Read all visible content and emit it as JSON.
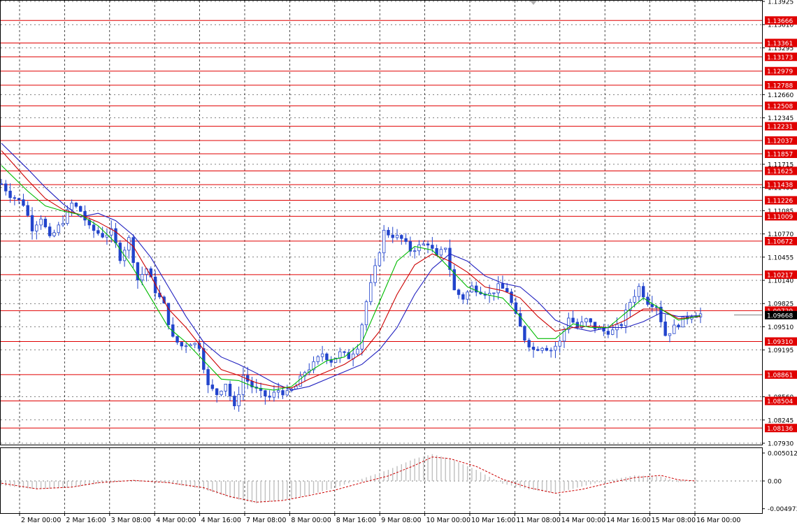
{
  "chart_data": [
    {
      "type": "line",
      "title": "",
      "description_series": "candlestick price with three moving averages",
      "y_price_labels": [
        "1.13925",
        "1.13610",
        "1.13295",
        "1.12660",
        "1.12345",
        "1.11715",
        "1.11400",
        "1.11085",
        "1.10770",
        "1.10455",
        "1.10140",
        "1.09825",
        "1.09510",
        "1.09195",
        "1.08560",
        "1.08245",
        "1.07930"
      ],
      "levels": [
        "1.13666",
        "1.13361",
        "1.13173",
        "1.12979",
        "1.12788",
        "1.12508",
        "1.12231",
        "1.12037",
        "1.11857",
        "1.11625",
        "1.11438",
        "1.11226",
        "1.11009",
        "1.10672",
        "1.10217",
        "1.09729",
        "1.09310",
        "1.08861",
        "1.08504",
        "1.08136"
      ],
      "current_price": "1.09668",
      "ylim": [
        1.0793,
        1.13925
      ],
      "x_labels": [
        "2 Mar 00:00",
        "2 Mar 16:00",
        "3 Mar 08:00",
        "4 Mar 00:00",
        "4 Mar 16:00",
        "7 Mar 08:00",
        "8 Mar 00:00",
        "8 Mar 16:00",
        "9 Mar 08:00",
        "10 Mar 00:00",
        "10 Mar 16:00",
        "11 Mar 08:00",
        "14 Mar 00:00",
        "14 Mar 16:00",
        "15 Mar 08:00",
        "16 Mar 00:00"
      ],
      "price_path": [
        [
          0,
          1.1145
        ],
        [
          2,
          1.113
        ],
        [
          5,
          1.1118
        ],
        [
          7,
          1.1085
        ],
        [
          9,
          1.11
        ],
        [
          11,
          1.107
        ],
        [
          14,
          1.1095
        ],
        [
          16,
          1.1118
        ],
        [
          18,
          1.1108
        ],
        [
          20,
          1.1085
        ],
        [
          23,
          1.1075
        ],
        [
          25,
          1.108
        ],
        [
          27,
          1.1045
        ],
        [
          29,
          1.107
        ],
        [
          31,
          1.1015
        ],
        [
          33,
          1.103
        ],
        [
          35,
          1.1
        ],
        [
          37,
          1.098
        ],
        [
          39,
          1.0935
        ],
        [
          41,
          1.0925
        ],
        [
          43,
          1.093
        ],
        [
          45,
          1.0925
        ],
        [
          47,
          1.087
        ],
        [
          49,
          1.086
        ],
        [
          51,
          1.0875
        ],
        [
          53,
          1.084
        ],
        [
          55,
          1.0885
        ],
        [
          57,
          1.087
        ],
        [
          59,
          1.086
        ],
        [
          61,
          1.0855
        ],
        [
          63,
          1.0865
        ],
        [
          65,
          1.086
        ],
        [
          67,
          1.087
        ],
        [
          69,
          1.089
        ],
        [
          71,
          1.09
        ],
        [
          73,
          1.0915
        ],
        [
          75,
          1.0905
        ],
        [
          77,
          1.0915
        ],
        [
          79,
          1.091
        ],
        [
          81,
          1.0925
        ],
        [
          83,
          1.0985
        ],
        [
          85,
          1.103
        ],
        [
          87,
          1.108
        ],
        [
          89,
          1.1075
        ],
        [
          91,
          1.107
        ],
        [
          93,
          1.1055
        ],
        [
          95,
          1.106
        ],
        [
          97,
          1.1065
        ],
        [
          99,
          1.1045
        ],
        [
          101,
          1.106
        ],
        [
          103,
          1.1
        ],
        [
          105,
          1.099
        ],
        [
          107,
          1.1005
        ],
        [
          109,
          1.1
        ],
        [
          111,
          1.0995
        ],
        [
          113,
          1.1005
        ],
        [
          115,
          1.1
        ],
        [
          117,
          1.0965
        ],
        [
          119,
          1.0935
        ],
        [
          121,
          1.092
        ],
        [
          123,
          1.0925
        ],
        [
          125,
          1.092
        ],
        [
          127,
          1.093
        ],
        [
          129,
          1.0965
        ],
        [
          131,
          1.095
        ],
        [
          133,
          1.096
        ],
        [
          135,
          1.095
        ],
        [
          137,
          1.0945
        ],
        [
          139,
          1.0945
        ],
        [
          141,
          1.0955
        ],
        [
          143,
          1.0985
        ],
        [
          145,
          1.1005
        ],
        [
          147,
          1.0985
        ],
        [
          149,
          1.098
        ],
        [
          151,
          1.094
        ],
        [
          153,
          1.095
        ],
        [
          155,
          1.096
        ],
        [
          157,
          1.0968
        ],
        [
          159,
          1.0968
        ]
      ],
      "series": [
        {
          "name": "",
          "color": "#1f1fbf",
          "values": [
            [
              0,
              1.12
            ],
            [
              6,
              1.1165
            ],
            [
              10,
              1.114
            ],
            [
              14,
              1.1118
            ],
            [
              18,
              1.11
            ],
            [
              22,
              1.1105
            ],
            [
              26,
              1.1095
            ],
            [
              30,
              1.1075
            ],
            [
              34,
              1.1045
            ],
            [
              38,
              1.1005
            ],
            [
              42,
              1.0965
            ],
            [
              46,
              1.093
            ],
            [
              50,
              1.091
            ],
            [
              54,
              1.09
            ],
            [
              58,
              1.0888
            ],
            [
              62,
              1.0875
            ],
            [
              66,
              1.0865
            ],
            [
              70,
              1.087
            ],
            [
              74,
              1.088
            ],
            [
              78,
              1.089
            ],
            [
              82,
              1.09
            ],
            [
              86,
              1.092
            ],
            [
              90,
              1.095
            ],
            [
              94,
              1.0995
            ],
            [
              98,
              1.103
            ],
            [
              102,
              1.105
            ],
            [
              106,
              1.104
            ],
            [
              110,
              1.102
            ],
            [
              114,
              1.101
            ],
            [
              118,
              1.1005
            ],
            [
              122,
              1.0985
            ],
            [
              126,
              1.096
            ],
            [
              130,
              1.095
            ],
            [
              134,
              1.0945
            ],
            [
              138,
              1.095
            ],
            [
              142,
              1.095
            ],
            [
              146,
              1.0958
            ],
            [
              150,
              1.097
            ],
            [
              154,
              1.0965
            ],
            [
              159,
              1.0966
            ]
          ]
        },
        {
          "name": "",
          "color": "#cc0000",
          "values": [
            [
              0,
              1.119
            ],
            [
              6,
              1.115
            ],
            [
              10,
              1.1125
            ],
            [
              14,
              1.111
            ],
            [
              18,
              1.1103
            ],
            [
              22,
              1.1093
            ],
            [
              26,
              1.108
            ],
            [
              30,
              1.106
            ],
            [
              34,
              1.102
            ],
            [
              38,
              1.0975
            ],
            [
              42,
              1.095
            ],
            [
              46,
              1.092
            ],
            [
              50,
              1.0893
            ],
            [
              54,
              1.0885
            ],
            [
              58,
              1.0875
            ],
            [
              62,
              1.087
            ],
            [
              66,
              1.0868
            ],
            [
              70,
              1.088
            ],
            [
              74,
              1.089
            ],
            [
              78,
              1.09
            ],
            [
              82,
              1.0915
            ],
            [
              86,
              1.0945
            ],
            [
              90,
              1.0995
            ],
            [
              94,
              1.1035
            ],
            [
              98,
              1.105
            ],
            [
              102,
              1.104
            ],
            [
              106,
              1.1025
            ],
            [
              110,
              1.1005
            ],
            [
              114,
              1.1
            ],
            [
              118,
              1.099
            ],
            [
              122,
              1.0965
            ],
            [
              126,
              1.0945
            ],
            [
              130,
              1.095
            ],
            [
              134,
              1.0952
            ],
            [
              138,
              1.095
            ],
            [
              142,
              1.096
            ],
            [
              146,
              1.0975
            ],
            [
              150,
              1.0975
            ],
            [
              154,
              1.0962
            ],
            [
              159,
              1.0965
            ]
          ]
        },
        {
          "name": "",
          "color": "#00bb00",
          "values": [
            [
              0,
              1.117
            ],
            [
              6,
              1.1135
            ],
            [
              10,
              1.1115
            ],
            [
              14,
              1.1108
            ],
            [
              18,
              1.1103
            ],
            [
              22,
              1.1088
            ],
            [
              26,
              1.1065
            ],
            [
              30,
              1.103
            ],
            [
              34,
              1.099
            ],
            [
              38,
              1.095
            ],
            [
              42,
              1.093
            ],
            [
              46,
              1.0905
            ],
            [
              50,
              1.088
            ],
            [
              54,
              1.0878
            ],
            [
              58,
              1.0868
            ],
            [
              62,
              1.0865
            ],
            [
              66,
              1.087
            ],
            [
              70,
              1.089
            ],
            [
              74,
              1.0905
            ],
            [
              78,
              1.091
            ],
            [
              82,
              1.093
            ],
            [
              86,
              1.0985
            ],
            [
              90,
              1.104
            ],
            [
              94,
              1.106
            ],
            [
              98,
              1.1055
            ],
            [
              102,
              1.103
            ],
            [
              106,
              1.1005
            ],
            [
              110,
              1.0995
            ],
            [
              114,
              1.099
            ],
            [
              118,
              1.0965
            ],
            [
              122,
              1.0935
            ],
            [
              126,
              1.0935
            ],
            [
              130,
              1.0955
            ],
            [
              134,
              1.095
            ],
            [
              138,
              1.095
            ],
            [
              142,
              1.097
            ],
            [
              146,
              1.099
            ],
            [
              150,
              1.0975
            ],
            [
              154,
              1.096
            ],
            [
              159,
              1.0966
            ]
          ]
        }
      ]
    },
    {
      "type": "bar",
      "title": "",
      "y_labels": [
        "0.005012",
        "0.00",
        "-0.004973"
      ],
      "ylim": [
        -0.004973,
        0.005012
      ],
      "histogram": [
        [
          0,
          -0.0008
        ],
        [
          8,
          -0.0015
        ],
        [
          16,
          -0.0012
        ],
        [
          22,
          -0.0005
        ],
        [
          30,
          0.0002
        ],
        [
          38,
          -0.0004
        ],
        [
          46,
          -0.0015
        ],
        [
          52,
          -0.003
        ],
        [
          58,
          -0.004
        ],
        [
          64,
          -0.0035
        ],
        [
          70,
          -0.0025
        ],
        [
          76,
          -0.0012
        ],
        [
          82,
          0.0004
        ],
        [
          88,
          0.002
        ],
        [
          94,
          0.004
        ],
        [
          98,
          0.0048
        ],
        [
          102,
          0.004
        ],
        [
          108,
          0.002
        ],
        [
          114,
          -0.0005
        ],
        [
          120,
          -0.0015
        ],
        [
          126,
          -0.0022
        ],
        [
          132,
          -0.001
        ],
        [
          138,
          0.0001
        ],
        [
          144,
          0.001
        ],
        [
          150,
          0.0008
        ],
        [
          154,
          -0.0002
        ],
        [
          158,
          0.0002
        ]
      ],
      "signal": [
        [
          0,
          -0.0004
        ],
        [
          8,
          -0.0014
        ],
        [
          16,
          -0.0011
        ],
        [
          22,
          -0.0003
        ],
        [
          30,
          0.0001
        ],
        [
          38,
          -0.0003
        ],
        [
          46,
          -0.0012
        ],
        [
          52,
          -0.0028
        ],
        [
          58,
          -0.0038
        ],
        [
          64,
          -0.0035
        ],
        [
          70,
          -0.0026
        ],
        [
          76,
          -0.0016
        ],
        [
          82,
          -0.0003
        ],
        [
          88,
          0.0009
        ],
        [
          94,
          0.0028
        ],
        [
          98,
          0.0043
        ],
        [
          102,
          0.004
        ],
        [
          108,
          0.0026
        ],
        [
          114,
          0.0003
        ],
        [
          120,
          -0.0012
        ],
        [
          126,
          -0.0022
        ],
        [
          132,
          -0.0015
        ],
        [
          138,
          -0.0004
        ],
        [
          144,
          0.0006
        ],
        [
          150,
          0.001
        ],
        [
          154,
          0.0002
        ],
        [
          158,
          0.0
        ]
      ],
      "signal_color": "#cc0000",
      "histogram_color": "#c0c0c0"
    }
  ]
}
